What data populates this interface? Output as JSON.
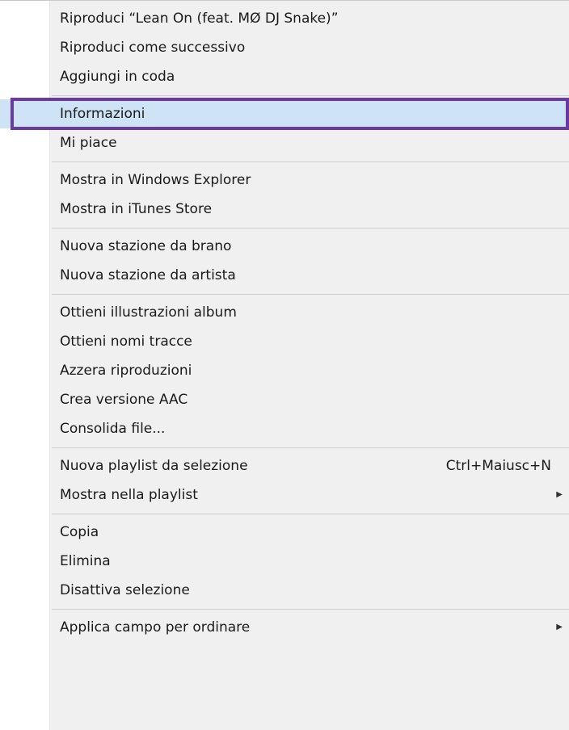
{
  "menu": {
    "groups": [
      [
        {
          "label": "Riproduci “Lean On (feat. MØ  DJ Snake)”"
        },
        {
          "label": "Riproduci come successivo"
        },
        {
          "label": "Aggiungi in coda"
        }
      ],
      [
        {
          "label": "Informazioni",
          "highlighted": true
        },
        {
          "label": "Mi piace"
        }
      ],
      [
        {
          "label": "Mostra in Windows Explorer"
        },
        {
          "label": "Mostra in iTunes Store"
        }
      ],
      [
        {
          "label": "Nuova stazione da brano"
        },
        {
          "label": "Nuova stazione da artista"
        }
      ],
      [
        {
          "label": "Ottieni illustrazioni album"
        },
        {
          "label": "Ottieni nomi tracce"
        },
        {
          "label": "Azzera riproduzioni"
        },
        {
          "label": "Crea versione AAC"
        },
        {
          "label": "Consolida file..."
        }
      ],
      [
        {
          "label": "Nuova playlist da selezione",
          "shortcut": "Ctrl+Maiusc+N"
        },
        {
          "label": "Mostra nella playlist",
          "submenu": true
        }
      ],
      [
        {
          "label": "Copia"
        },
        {
          "label": "Elimina"
        },
        {
          "label": "Disattiva selezione"
        }
      ],
      [
        {
          "label": "Applica campo per ordinare",
          "submenu": true
        }
      ]
    ],
    "submenu_arrow_icon": "▶",
    "colors": {
      "background": "#f0f0f0",
      "gutter": "#ffffff",
      "highlight_fill": "#cfe3f6",
      "highlight_border": "#6a3aa3",
      "separator": "#cfcfcf"
    }
  }
}
